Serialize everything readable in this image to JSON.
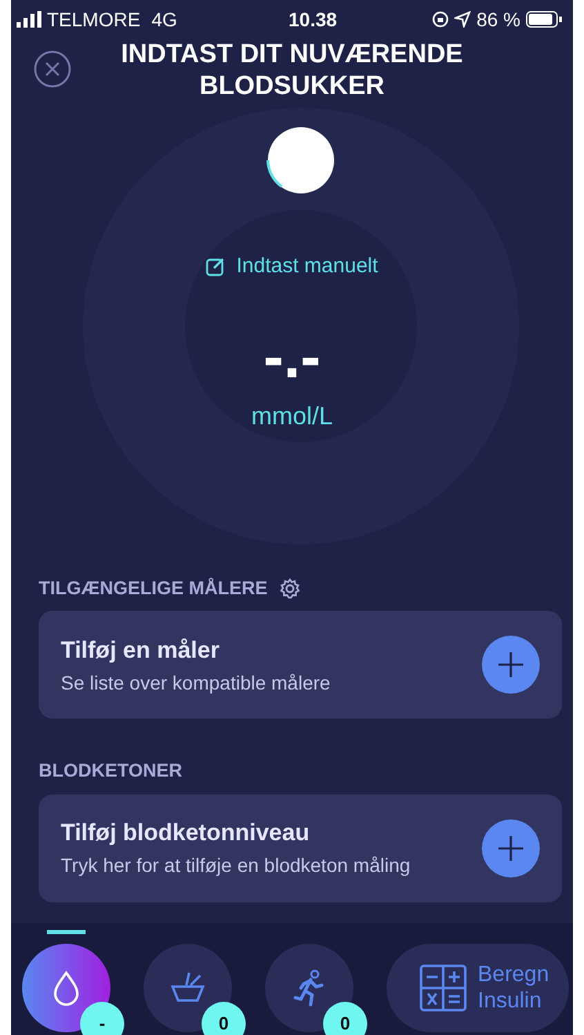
{
  "status_bar": {
    "carrier": "TELMORE",
    "network": "4G",
    "time": "10.38",
    "battery": "86 %"
  },
  "header": {
    "title": "INDTAST DIT NUVÆRENDE BLODSUKKER"
  },
  "reading": {
    "manual_link": "Indtast manuelt",
    "value": "-.-",
    "unit": "mmol/L"
  },
  "sections": [
    {
      "heading": "TILGÆNGELIGE MÅLERE",
      "settings": true,
      "card": {
        "title": "Tilføj en måler",
        "subtitle": "Se liste over kompatible målere"
      }
    },
    {
      "heading": "BLODKETONER",
      "settings": false,
      "card": {
        "title": "Tilføj blodketonniveau",
        "subtitle": "Tryk her for at tilføje en blodketon måling"
      }
    }
  ],
  "bottom_nav": [
    {
      "kind": "drop",
      "selected": true,
      "badge": "-"
    },
    {
      "kind": "food",
      "selected": false,
      "badge": "0"
    },
    {
      "kind": "exercise",
      "selected": false,
      "badge": "0"
    },
    {
      "kind": "calculator",
      "selected": false,
      "label": "Beregn Insulin"
    }
  ]
}
